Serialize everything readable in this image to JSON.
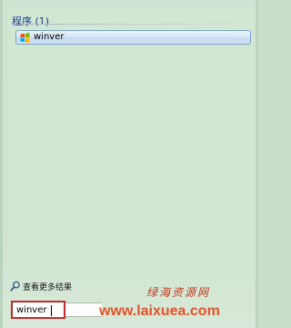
{
  "results": {
    "group_header": "程序 (1)",
    "items": [
      {
        "label": "winver",
        "icon": "windows-logo-icon"
      }
    ]
  },
  "footer": {
    "see_more_label": "查看更多结果",
    "search_value": "winver",
    "search_icon": "magnifier-icon"
  },
  "watermark": {
    "cn_text": "绿海资源网",
    "url": "www.laixuea.com",
    "color": "#e2542b"
  }
}
